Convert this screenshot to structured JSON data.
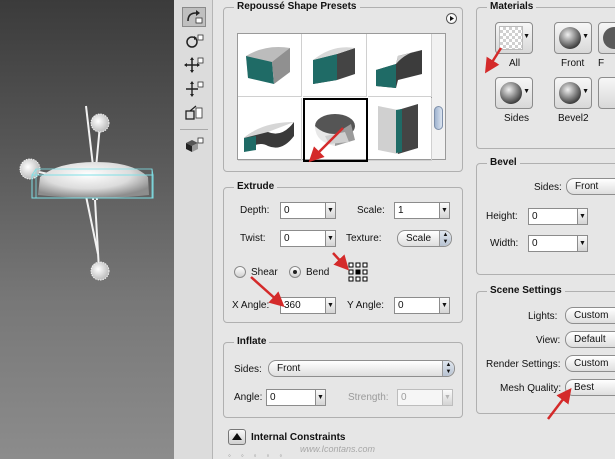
{
  "tools": [
    {
      "name": "rotate-tool-icon",
      "active": true
    },
    {
      "name": "roll-tool-icon",
      "active": false
    },
    {
      "name": "drag-tool-icon",
      "active": false
    },
    {
      "name": "slide-tool-icon",
      "active": false
    },
    {
      "name": "scale-tool-icon",
      "active": false
    },
    {
      "name": "lights-tool-icon",
      "active": false
    }
  ],
  "presets": {
    "title": "Repoussé Shape Presets",
    "menu_icon": "play-circle-icon",
    "selected_index": 4,
    "items": [
      "bend-arch",
      "bend-box",
      "twist-slab",
      "wave-slab",
      "notched-disc",
      "flat-slab"
    ]
  },
  "extrude": {
    "title": "Extrude",
    "depth_label": "Depth:",
    "depth_value": "0",
    "scale_label": "Scale:",
    "scale_value": "1",
    "twist_label": "Twist:",
    "twist_value": "0",
    "texture_label": "Texture:",
    "texture_value": "Scale",
    "shear_label": "Shear",
    "bend_label": "Bend",
    "bend_selected": true,
    "x_angle_label": "X Angle:",
    "x_angle_value": "360",
    "y_angle_label": "Y Angle:",
    "y_angle_value": "0"
  },
  "inflate": {
    "title": "Inflate",
    "sides_label": "Sides:",
    "sides_value": "Front",
    "angle_label": "Angle:",
    "angle_value": "0",
    "strength_label": "Strength:",
    "strength_value": "0"
  },
  "internal_constraints": {
    "title": "Internal Constraints",
    "toggle_icon": "triangle-up-icon"
  },
  "materials": {
    "title": "Materials",
    "items": [
      {
        "label": "All",
        "swatch": "transparent-checker"
      },
      {
        "label": "Front",
        "swatch": "gray-sphere"
      },
      {
        "label": "Sides",
        "swatch": "gray-sphere"
      },
      {
        "label": "Bevel2",
        "swatch": "gray-sphere"
      }
    ]
  },
  "bevel": {
    "title": "Bevel",
    "sides_label": "Sides:",
    "sides_value": "Front",
    "height_label": "Height:",
    "height_value": "0",
    "width_label": "Width:",
    "width_value": "0"
  },
  "scene": {
    "title": "Scene Settings",
    "lights_label": "Lights:",
    "lights_value": "Custom",
    "view_label": "View:",
    "view_value": "Default",
    "render_label": "Render Settings:",
    "render_value": "Custom",
    "mesh_label": "Mesh Quality:",
    "mesh_value": "Best"
  },
  "watermark": "www.Icontans.com",
  "colors": {
    "annotation_arrow": "#d42a2a",
    "bounding_box": "#7fe0e6",
    "extrude_teal": "#1f6b66"
  }
}
